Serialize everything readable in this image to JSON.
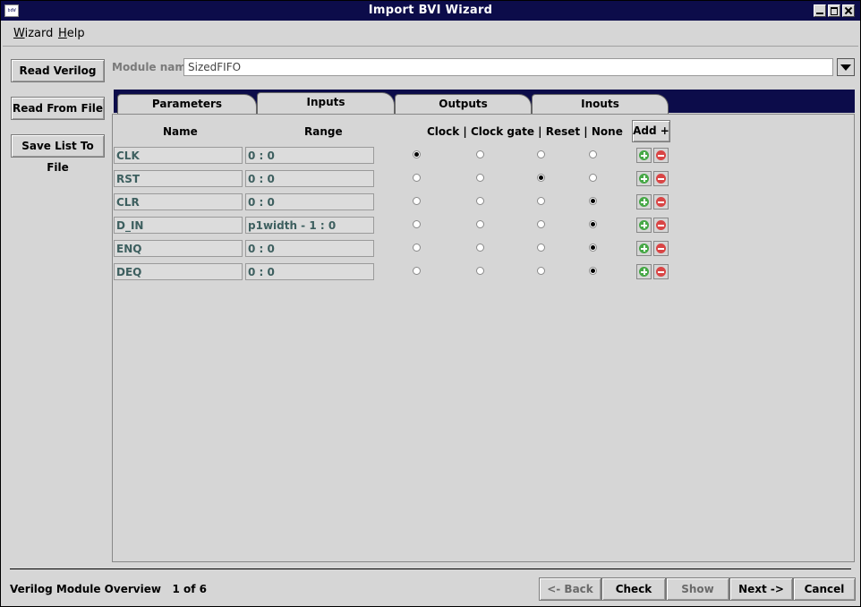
{
  "window": {
    "title": "Import BVI Wizard",
    "app_icon_text": "bdW"
  },
  "menu": [
    "Wizard",
    "Help"
  ],
  "sidebar": [
    "Read Verilog",
    "Read From File",
    "Save List To File"
  ],
  "module": {
    "label": "Module name",
    "value": "SizedFIFO"
  },
  "tabs": [
    "Parameters",
    "Inputs",
    "Outputs",
    "Inouts"
  ],
  "active_tab": "Inputs",
  "table": {
    "headers": {
      "name": "Name",
      "range": "Range",
      "kind": "Clock | Clock gate | Reset | None",
      "add": "Add +"
    },
    "kinds": [
      "Clock",
      "Clock gate",
      "Reset",
      "None"
    ],
    "rows": [
      {
        "name": "CLK",
        "range": "0 : 0",
        "kind": "Clock"
      },
      {
        "name": "RST",
        "range": "0 : 0",
        "kind": "Reset"
      },
      {
        "name": "CLR",
        "range": "0 : 0",
        "kind": "None"
      },
      {
        "name": "D_IN",
        "range": "p1width - 1  :  0",
        "kind": "None"
      },
      {
        "name": "ENQ",
        "range": "0 : 0",
        "kind": "None"
      },
      {
        "name": "DEQ",
        "range": "0 : 0",
        "kind": "None"
      }
    ]
  },
  "status": {
    "step_label": "Verilog Module Overview",
    "step_count": "1 of 6"
  },
  "nav": {
    "back": "<- Back",
    "check": "Check",
    "show": "Show",
    "next": "Next ->",
    "cancel": "Cancel"
  },
  "icons": {
    "window": [
      "app-icon",
      "minimize-icon",
      "maximize-icon",
      "close-icon"
    ],
    "row": [
      "add-row-icon",
      "remove-row-icon"
    ],
    "module": [
      "chevron-down-icon"
    ]
  },
  "colors": {
    "titlebar": "#0c0c4a",
    "background": "#d6d6d6",
    "cell_text": "#3d5f5f",
    "add_icon": "#46a846",
    "remove_icon": "#d94545"
  }
}
